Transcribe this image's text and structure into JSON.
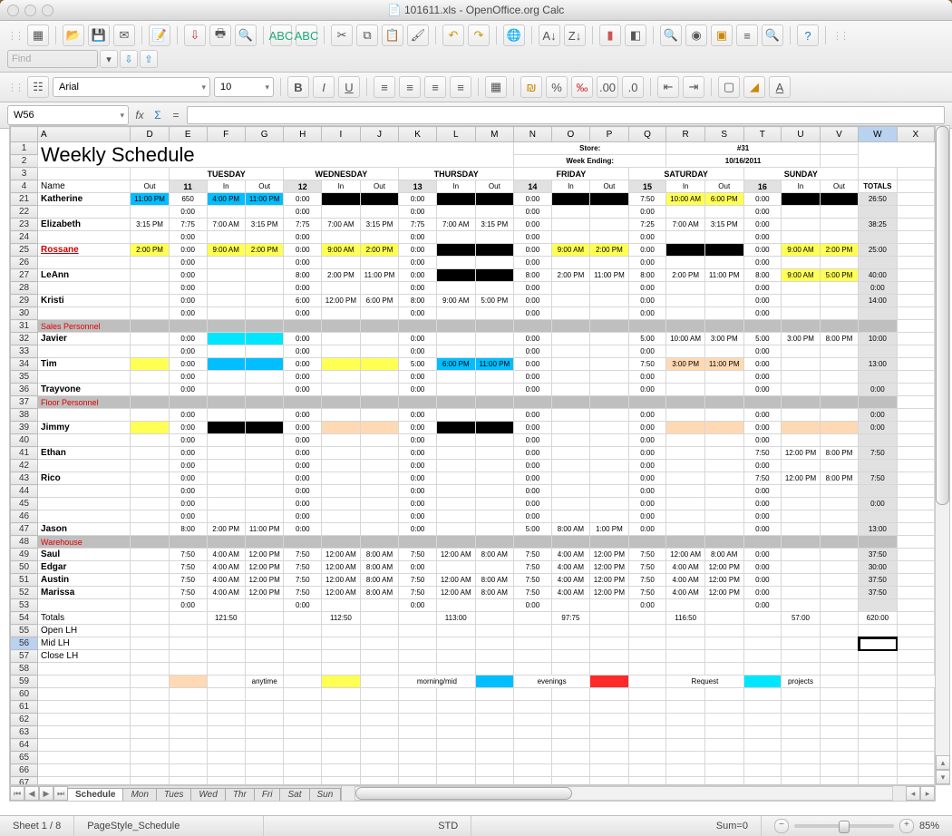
{
  "window_title": "101611.xls - OpenOffice.org Calc",
  "find_placeholder": "Find",
  "font_name": "Arial",
  "font_size": "10",
  "cell_ref": "W56",
  "columns": [
    "A",
    "D",
    "E",
    "F",
    "G",
    "H",
    "I",
    "J",
    "K",
    "L",
    "M",
    "N",
    "O",
    "P",
    "Q",
    "R",
    "S",
    "T",
    "U",
    "V",
    "W",
    "X"
  ],
  "title_text": "Weekly Schedule",
  "store_label": "Store:",
  "store_value": "#31",
  "week_ending_label": "Week Ending:",
  "week_ending_value": "10/16/2011",
  "days": [
    "TUESDAY",
    "WEDNESDAY",
    "THURSDAY",
    "FRIDAY",
    "SATURDAY",
    "SUNDAY"
  ],
  "subhdr_first": "Name",
  "subhdr_out": "Out",
  "subhdr_daynums": [
    "11",
    "12",
    "13",
    "14",
    "15",
    "16"
  ],
  "subhdr_in": "In",
  "subhdr_totals": "TOTALS",
  "legend": {
    "anytime": "anytime",
    "morningmid": "morning/mid",
    "evenings": "evenings",
    "request": "Request",
    "projects": "projects"
  },
  "totals_row_label": "Totals",
  "open_lh": "Open LH",
  "mid_lh": "Mid LH",
  "close_lh": "Close LH",
  "day_totals": [
    "121:50",
    "112:50",
    "113:00",
    "97:75",
    "116:50",
    "57:00"
  ],
  "grand_total": "620:00",
  "sheet_tabs": [
    "Schedule",
    "Mon",
    "Tues",
    "Wed",
    "Thr",
    "Fri",
    "Sat",
    "Sun"
  ],
  "status": {
    "sheet": "Sheet 1 / 8",
    "style": "PageStyle_Schedule",
    "mode": "STD",
    "sum": "Sum=0",
    "zoom": "85%"
  },
  "rows": [
    {
      "r": 21,
      "name": "Katherine",
      "nameCls": "nm",
      "cells": [
        "11:00 PM|cy",
        "650|",
        "4:00 PM|cy",
        "11:00 PM|cy",
        "0:00|",
        "|black",
        "|black",
        "0:00|",
        "|black",
        "|black",
        "0:00|",
        "|black",
        "|black",
        "7:50|",
        "10:00 AM|yl",
        "6:00 PM|yl",
        "0:00|",
        "|black",
        "|black",
        "26:50|shade"
      ]
    },
    {
      "r": 22,
      "name": "",
      "cells": [
        "|",
        "0:00|",
        "|",
        "|",
        "0:00|",
        "|",
        "|",
        "0:00|",
        "|",
        "|",
        "0:00|",
        "|",
        "|",
        "0:00|",
        "|",
        "|",
        "0:00|",
        "|",
        "|",
        "|shade"
      ]
    },
    {
      "r": 23,
      "name": "Elizabeth",
      "nameCls": "nm",
      "cells": [
        "3:15 PM|",
        "7:75|",
        "7:00 AM|",
        "3:15 PM|",
        "7:75|",
        "7:00 AM|",
        "3:15 PM|",
        "7:75|",
        "7:00 AM|",
        "3:15 PM|",
        "0:00|",
        "|",
        "|",
        "7:25|",
        "7:00 AM|",
        "3:15 PM|",
        "0:00|",
        "|",
        "|",
        "38:25|shade"
      ]
    },
    {
      "r": 24,
      "name": "",
      "cells": [
        "|",
        "0:00|",
        "|",
        "|",
        "0:00|",
        "|",
        "|",
        "0:00|",
        "|",
        "|",
        "0:00|",
        "|",
        "|",
        "0:00|",
        "|",
        "|",
        "0:00|",
        "|",
        "|",
        "|shade"
      ]
    },
    {
      "r": 25,
      "name": "Rossane",
      "nameCls": "nmRed",
      "cells": [
        "2:00 PM|yl",
        "0:00|",
        "9:00 AM|yl",
        "2:00 PM|yl",
        "0:00|",
        "9:00 AM|yl",
        "2:00 PM|yl",
        "0:00|",
        "|black",
        "|black",
        "0:00|",
        "9:00 AM|yl",
        "2:00 PM|yl",
        "0:00|",
        "|black",
        "|black",
        "0:00|",
        "9:00 AM|yl",
        "2:00 PM|yl",
        "25:00|shade"
      ]
    },
    {
      "r": 26,
      "name": "",
      "cells": [
        "|",
        "0:00|",
        "|",
        "|",
        "0:00|",
        "|",
        "|",
        "0:00|",
        "|",
        "|",
        "0:00|",
        "|",
        "|",
        "0:00|",
        "|",
        "|",
        "0:00|",
        "|",
        "|",
        "|shade"
      ]
    },
    {
      "r": 27,
      "name": "LeAnn",
      "nameCls": "nm",
      "cells": [
        "|",
        "0:00|",
        "|",
        "|",
        "8:00|",
        "2:00 PM|",
        "11:00 PM|",
        "0:00|",
        "|black",
        "|black",
        "8:00|",
        "2:00 PM|",
        "11:00 PM|",
        "8:00|",
        "2:00 PM|",
        "11:00 PM|",
        "8:00|",
        "9:00 AM|yl",
        "5:00 PM|yl",
        "40:00|shade"
      ]
    },
    {
      "r": 28,
      "name": "",
      "cells": [
        "|",
        "0:00|",
        "|",
        "|",
        "0:00|",
        "|",
        "|",
        "0:00|",
        "|",
        "|",
        "0:00|",
        "|",
        "|",
        "0:00|",
        "|",
        "|",
        "0:00|",
        "|",
        "|",
        "0:00|shade"
      ]
    },
    {
      "r": 29,
      "name": "Kristi",
      "nameCls": "nm",
      "cells": [
        "|",
        "0:00|",
        "|",
        "|",
        "6:00|",
        "12:00 PM|",
        "6:00 PM|",
        "8:00|",
        "9:00 AM|",
        "5:00 PM|",
        "0:00|",
        "|",
        "|",
        "0:00|",
        "|",
        "|",
        "0:00|",
        "|",
        "|",
        "14:00|shade"
      ]
    },
    {
      "r": 30,
      "name": "",
      "cells": [
        "|",
        "0:00|",
        "|",
        "|",
        "0:00|",
        "|",
        "|",
        "0:00|",
        "|",
        "|",
        "0:00|",
        "|",
        "|",
        "0:00|",
        "|",
        "|",
        "0:00|",
        "|",
        "|",
        "|shade"
      ]
    },
    {
      "r": 31,
      "name": "Sales Personnel",
      "nameCls": "sec",
      "sect": true
    },
    {
      "r": 32,
      "name": "Javier",
      "nameCls": "nm",
      "cells": [
        "|",
        "0:00|",
        "|cy2",
        "|cy2",
        "0:00|",
        "|",
        "|",
        "0:00|",
        "|",
        "|",
        "0:00|",
        "|",
        "|",
        "5:00|",
        "10:00 AM|",
        "3:00 PM|",
        "5:00|",
        "3:00 PM|",
        "8:00 PM|",
        "10:00|shade"
      ]
    },
    {
      "r": 33,
      "name": "",
      "cells": [
        "|",
        "0:00|",
        "|",
        "|",
        "0:00|",
        "|",
        "|",
        "0:00|",
        "|",
        "|",
        "0:00|",
        "|",
        "|",
        "0:00|",
        "|",
        "|",
        "0:00|",
        "|",
        "|",
        "|shade"
      ]
    },
    {
      "r": 34,
      "name": "Tim",
      "nameCls": "nm",
      "cells": [
        "|yl",
        "0:00|",
        "|cy",
        "|cy",
        "0:00|",
        "|yl",
        "|yl",
        "5:00|",
        "6:00 PM|cy",
        "11:00 PM|cy",
        "0:00|",
        "|",
        "|",
        "7:50|",
        "3:00 PM|or",
        "11:00 PM|or",
        "0:00|",
        "|",
        "|",
        "13:00|shade"
      ]
    },
    {
      "r": 35,
      "name": "",
      "cells": [
        "|",
        "0:00|",
        "|",
        "|",
        "0:00|",
        "|",
        "|",
        "0:00|",
        "|",
        "|",
        "0:00|",
        "|",
        "|",
        "0:00|",
        "|",
        "|",
        "0:00|",
        "|",
        "|",
        "|shade"
      ]
    },
    {
      "r": 36,
      "name": "Trayvone",
      "nameCls": "nm",
      "cells": [
        "|",
        "0:00|",
        "|",
        "|",
        "0:00|",
        "|",
        "|",
        "0:00|",
        "|",
        "|",
        "0:00|",
        "|",
        "|",
        "0:00|",
        "|",
        "|",
        "0:00|",
        "|",
        "|",
        "0:00|shade"
      ]
    },
    {
      "r": 37,
      "name": "Floor Personnel",
      "nameCls": "sec",
      "sect": true
    },
    {
      "r": 38,
      "name": "",
      "cells": [
        "|",
        "0:00|",
        "|",
        "|",
        "0:00|",
        "|",
        "|",
        "0:00|",
        "|",
        "|",
        "0:00|",
        "|",
        "|",
        "0:00|",
        "|",
        "|",
        "0:00|",
        "|",
        "|",
        "0:00|shade"
      ]
    },
    {
      "r": 39,
      "name": "Jimmy",
      "nameCls": "nm",
      "cells": [
        "|yl",
        "0:00|",
        "|black",
        "|black",
        "0:00|",
        "|or",
        "|or",
        "0:00|",
        "|black",
        "|black",
        "0:00|",
        "|",
        "|",
        "0:00|",
        "|or",
        "|or",
        "0:00|",
        "|or",
        "|or",
        "0:00|shade"
      ]
    },
    {
      "r": 40,
      "name": "",
      "cells": [
        "|",
        "0:00|",
        "|",
        "|",
        "0:00|",
        "|",
        "|",
        "0:00|",
        "|",
        "|",
        "0:00|",
        "|",
        "|",
        "0:00|",
        "|",
        "|",
        "0:00|",
        "|",
        "|",
        "|shade"
      ]
    },
    {
      "r": 41,
      "name": "Ethan",
      "nameCls": "nm",
      "cells": [
        "|",
        "0:00|",
        "|",
        "|",
        "0:00|",
        "|",
        "|",
        "0:00|",
        "|",
        "|",
        "0:00|",
        "|",
        "|",
        "0:00|",
        "|",
        "|",
        "7:50|",
        "12:00 PM|",
        "8:00 PM|",
        "7:50|shade"
      ]
    },
    {
      "r": 42,
      "name": "",
      "cells": [
        "|",
        "0:00|",
        "|",
        "|",
        "0:00|",
        "|",
        "|",
        "0:00|",
        "|",
        "|",
        "0:00|",
        "|",
        "|",
        "0:00|",
        "|",
        "|",
        "0:00|",
        "|",
        "|",
        "|shade"
      ]
    },
    {
      "r": 43,
      "name": "Rico",
      "nameCls": "nm",
      "cells": [
        "|",
        "0:00|",
        "|",
        "|",
        "0:00|",
        "|",
        "|",
        "0:00|",
        "|",
        "|",
        "0:00|",
        "|",
        "|",
        "0:00|",
        "|",
        "|",
        "7:50|",
        "12:00 PM|",
        "8:00 PM|",
        "7:50|shade"
      ]
    },
    {
      "r": 44,
      "name": "",
      "cells": [
        "|",
        "0:00|",
        "|",
        "|",
        "0:00|",
        "|",
        "|",
        "0:00|",
        "|",
        "|",
        "0:00|",
        "|",
        "|",
        "0:00|",
        "|",
        "|",
        "0:00|",
        "|",
        "|",
        "|shade"
      ]
    },
    {
      "r": 45,
      "name": "",
      "cells": [
        "|",
        "0:00|",
        "|",
        "|",
        "0:00|",
        "|",
        "|",
        "0:00|",
        "|",
        "|",
        "0:00|",
        "|",
        "|",
        "0:00|",
        "|",
        "|",
        "0:00|",
        "|",
        "|",
        "0:00|shade"
      ]
    },
    {
      "r": 46,
      "name": "",
      "cells": [
        "|",
        "0:00|",
        "|",
        "|",
        "0:00|",
        "|",
        "|",
        "0:00|",
        "|",
        "|",
        "0:00|",
        "|",
        "|",
        "0:00|",
        "|",
        "|",
        "0:00|",
        "|",
        "|",
        "|shade"
      ]
    },
    {
      "r": 47,
      "name": "Jason",
      "nameCls": "nm",
      "cells": [
        "|",
        "8:00|",
        "2:00 PM|",
        "11:00 PM|",
        "0:00|",
        "|",
        "|",
        "0:00|",
        "|",
        "|",
        "5:00|",
        "8:00 AM|",
        "1:00 PM|",
        "0:00|",
        "|",
        "|",
        "0:00|",
        "|",
        "|",
        "13:00|shade"
      ]
    },
    {
      "r": 48,
      "name": "Warehouse",
      "nameCls": "sec",
      "sect": true
    },
    {
      "r": 49,
      "name": "Saul",
      "nameCls": "nm",
      "cells": [
        "|",
        "7:50|",
        "4:00 AM|",
        "12:00 PM|",
        "7:50|",
        "12:00 AM|",
        "8:00 AM|",
        "7:50|",
        "12:00 AM|",
        "8:00 AM|",
        "7:50|",
        "4:00 AM|",
        "12:00 PM|",
        "7:50|",
        "12:00 AM|",
        "8:00 AM|",
        "0:00|",
        "|",
        "|",
        "37:50|shade"
      ]
    },
    {
      "r": 50,
      "name": "Edgar",
      "nameCls": "nm",
      "cells": [
        "|",
        "7:50|",
        "4:00 AM|",
        "12:00 PM|",
        "7:50|",
        "12:00 AM|",
        "8:00 AM|",
        "0:00|",
        "|",
        "|",
        "7:50|",
        "4:00 AM|",
        "12:00 PM|",
        "7:50|",
        "4:00 AM|",
        "12:00 PM|",
        "0:00|",
        "|",
        "|",
        "30:00|shade"
      ]
    },
    {
      "r": 51,
      "name": "Austin",
      "nameCls": "nm",
      "cells": [
        "|",
        "7:50|",
        "4:00 AM|",
        "12:00 PM|",
        "7:50|",
        "12:00 AM|",
        "8:00 AM|",
        "7:50|",
        "12:00 AM|",
        "8:00 AM|",
        "7:50|",
        "4:00 AM|",
        "12:00 PM|",
        "7:50|",
        "4:00 AM|",
        "12:00 PM|",
        "0:00|",
        "|",
        "|",
        "37:50|shade"
      ]
    },
    {
      "r": 52,
      "name": "Marissa",
      "nameCls": "nm",
      "cells": [
        "|",
        "7:50|",
        "4:00 AM|",
        "12:00 PM|",
        "7:50|",
        "12:00 AM|",
        "8:00 AM|",
        "7:50|",
        "12:00 AM|",
        "8:00 AM|",
        "7:50|",
        "4:00 AM|",
        "12:00 PM|",
        "7:50|",
        "4:00 AM|",
        "12:00 PM|",
        "0:00|",
        "|",
        "|",
        "37:50|shade"
      ]
    },
    {
      "r": 53,
      "name": "",
      "cells": [
        "|",
        "0:00|",
        "|",
        "|",
        "0:00|",
        "|",
        "|",
        "0:00|",
        "|",
        "|",
        "0:00|",
        "|",
        "|",
        "0:00|",
        "|",
        "|",
        "0:00|",
        "|",
        "|",
        "|shade"
      ]
    }
  ]
}
